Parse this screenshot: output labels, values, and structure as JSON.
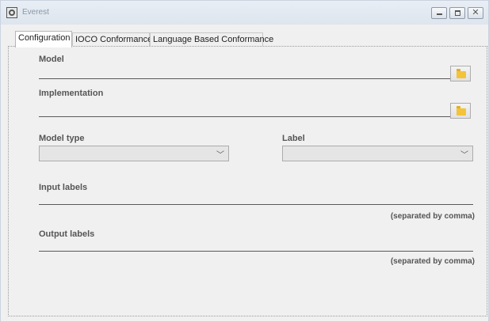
{
  "window": {
    "title": "Everest"
  },
  "tabs": [
    {
      "label": "Configuration",
      "active": true
    },
    {
      "label": "IOCO Conformance",
      "active": false
    },
    {
      "label": "Language Based Conformance",
      "active": false
    }
  ],
  "form": {
    "model": {
      "label": "Model",
      "value": ""
    },
    "implementation": {
      "label": "Implementation",
      "value": ""
    },
    "model_type": {
      "label": "Model type",
      "selected": ""
    },
    "label": {
      "label": "Label",
      "selected": ""
    },
    "input_labels": {
      "label": "Input labels",
      "value": "",
      "hint": "(separated by comma)"
    },
    "output_labels": {
      "label": "Output  labels",
      "value": "",
      "hint": "(separated by comma)"
    }
  },
  "icons": {
    "app": "app-icon",
    "minimize": "minimize-icon",
    "maximize": "maximize-icon",
    "close": "close-icon",
    "browse": "folder-icon",
    "dropdown": "chevron-down-icon"
  },
  "colors": {
    "folder": "#f3c33a",
    "title_text": "#8a96a3"
  }
}
